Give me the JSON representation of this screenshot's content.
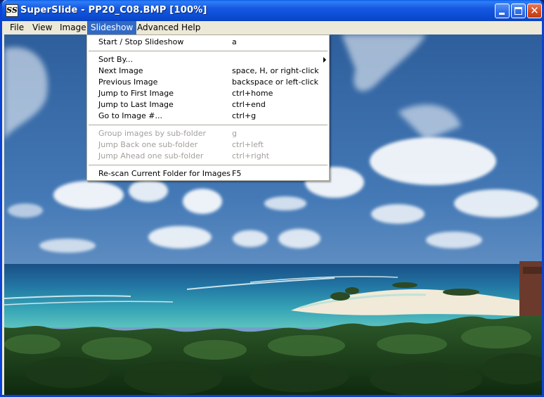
{
  "window": {
    "title": "SuperSlide - PP20_C08.BMP [100%]",
    "icon_label": "SS"
  },
  "menubar": {
    "items": [
      {
        "label": "File"
      },
      {
        "label": "View"
      },
      {
        "label": "Image"
      },
      {
        "label": "Slideshow"
      },
      {
        "label": "Advanced"
      },
      {
        "label": "Help"
      }
    ]
  },
  "slideshow_menu": {
    "items": [
      {
        "label": "Start / Stop Slideshow",
        "shortcut": "a",
        "enabled": true
      },
      {
        "label": "Sort By...",
        "shortcut": "",
        "enabled": true,
        "submenu": true
      },
      {
        "label": "Next Image",
        "shortcut": "space, H, or right-click",
        "enabled": true
      },
      {
        "label": "Previous Image",
        "shortcut": "backspace or left-click",
        "enabled": true
      },
      {
        "label": "Jump to First Image",
        "shortcut": "ctrl+home",
        "enabled": true
      },
      {
        "label": "Jump to Last Image",
        "shortcut": "ctrl+end",
        "enabled": true
      },
      {
        "label": "Go to Image #...",
        "shortcut": "ctrl+g",
        "enabled": true
      },
      {
        "label": "Group images by sub-folder",
        "shortcut": "g",
        "enabled": false
      },
      {
        "label": "Jump Back one sub-folder",
        "shortcut": "ctrl+left",
        "enabled": false
      },
      {
        "label": "Jump Ahead one sub-folder",
        "shortcut": "ctrl+right",
        "enabled": false
      },
      {
        "label": "Re-scan Current Folder for Images",
        "shortcut": "F5",
        "enabled": true
      }
    ]
  },
  "colors": {
    "titlebar": "#0c4fd6",
    "menu_highlight": "#316ac5",
    "disabled_text": "#a3a09a"
  }
}
